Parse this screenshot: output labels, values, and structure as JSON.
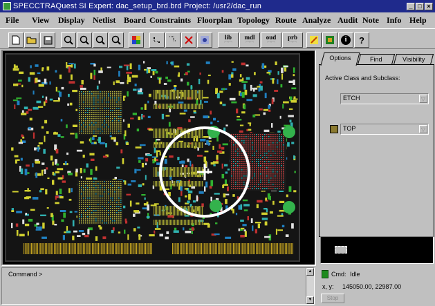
{
  "window": {
    "title": "SPECCTRAQuest SI Expert: dac_setup_brd.brd  Project: /usr2/dac_run",
    "minimize_label": "_",
    "maximize_label": "□",
    "close_label": "×"
  },
  "menu": [
    {
      "label": "File"
    },
    {
      "label": "View"
    },
    {
      "label": "Display"
    },
    {
      "label": "Netlist"
    },
    {
      "label": "Board"
    },
    {
      "label": "Constraints"
    },
    {
      "label": "Floorplan"
    },
    {
      "label": "Topology"
    },
    {
      "label": "Route"
    },
    {
      "label": "Analyze"
    },
    {
      "label": "Audit"
    },
    {
      "label": "Note"
    },
    {
      "label": "Info"
    },
    {
      "label": "Help"
    }
  ],
  "toolbar": {
    "lib_label": "lib",
    "mdl_label": "mdl",
    "oud_label": "oud",
    "prb_label": "prb",
    "help_label": "?",
    "info_label": "i"
  },
  "side": {
    "tabs": [
      {
        "label": "Options"
      },
      {
        "label": "Find"
      },
      {
        "label": "Visibility"
      }
    ],
    "active_label": "Active Class and Subclass:",
    "class_value": "ETCH",
    "subclass_value": "TOP"
  },
  "command": {
    "prompt": "Command >"
  },
  "status": {
    "cmd_label": "Cmd:",
    "cmd_value": "Idle",
    "xy_label": "x, y:",
    "xy_value": "145050.00, 22987.00",
    "stop_label": "Stop"
  },
  "colors": {
    "titlebar": "#1f2a8c",
    "pcb_background": "#000000",
    "board_outline": "#3a3a3a",
    "via_green": "#33b24c",
    "etch_top": "#8b7a30",
    "status_idle": "#1c8a1c"
  }
}
